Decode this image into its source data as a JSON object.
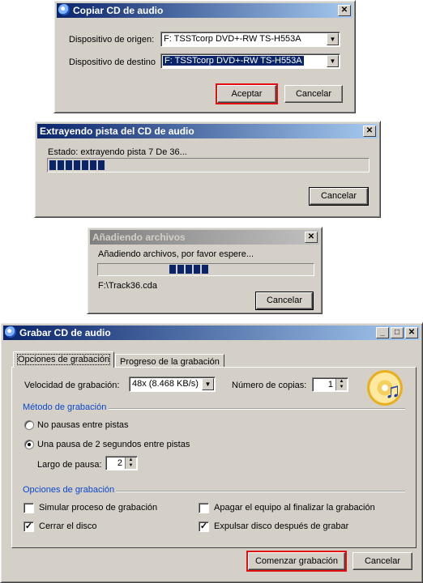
{
  "copy_dialog": {
    "title": "Copiar CD de audio",
    "source_label": "Dispositivo de origen:",
    "source_value": "F: TSSTcorp DVD+-RW TS-H553A",
    "dest_label": "Dispositivo de destino",
    "dest_value": "F: TSSTcorp DVD+-RW TS-H553A",
    "accept": "Aceptar",
    "cancel": "Cancelar"
  },
  "extract_dialog": {
    "title": "Extrayendo pista del CD de audio",
    "status": "Estado: extrayendo pista 7 De 36...",
    "progress_fraction": 0.19,
    "cancel": "Cancelar"
  },
  "adding_dialog": {
    "title": "Añadiendo archivos",
    "message": "Añadiendo archivos, por favor espere...",
    "file": "F:\\Track36.cda",
    "cancel": "Cancelar"
  },
  "burn_dialog": {
    "title": "Grabar CD de audio",
    "tabs": [
      "Opciones de grabación",
      "Progreso de la grabación"
    ],
    "speed_label": "Velocidad de grabación:",
    "speed_value": "48x (8.468 KB/s)",
    "copies_label": "Número de copias:",
    "copies_value": "1",
    "method_group": "Método de grabación",
    "radio_no_pause": "No pausas entre pistas",
    "radio_pause": "Una pausa de 2 segundos entre pistas",
    "pause_length_label": "Largo de pausa:",
    "pause_length_value": "2",
    "options_group": "Opciones de grabación",
    "opt_simulate": "Simular proceso de grabación",
    "opt_close_disc": "Cerrar el disco",
    "opt_shutdown": "Apagar el equipo al finalizar la grabación",
    "opt_eject": "Expulsar disco después de grabar",
    "start": "Comenzar grabación",
    "cancel": "Cancelar"
  },
  "colors": {
    "title_active": "#0a246a",
    "highlight_red": "#e01010",
    "group_label": "#0a46ce"
  },
  "icons": [
    "app-disc-icon",
    "close-icon",
    "minimize-icon",
    "maximize-icon",
    "dropdown-arrow-icon",
    "cd-music-icon"
  ]
}
